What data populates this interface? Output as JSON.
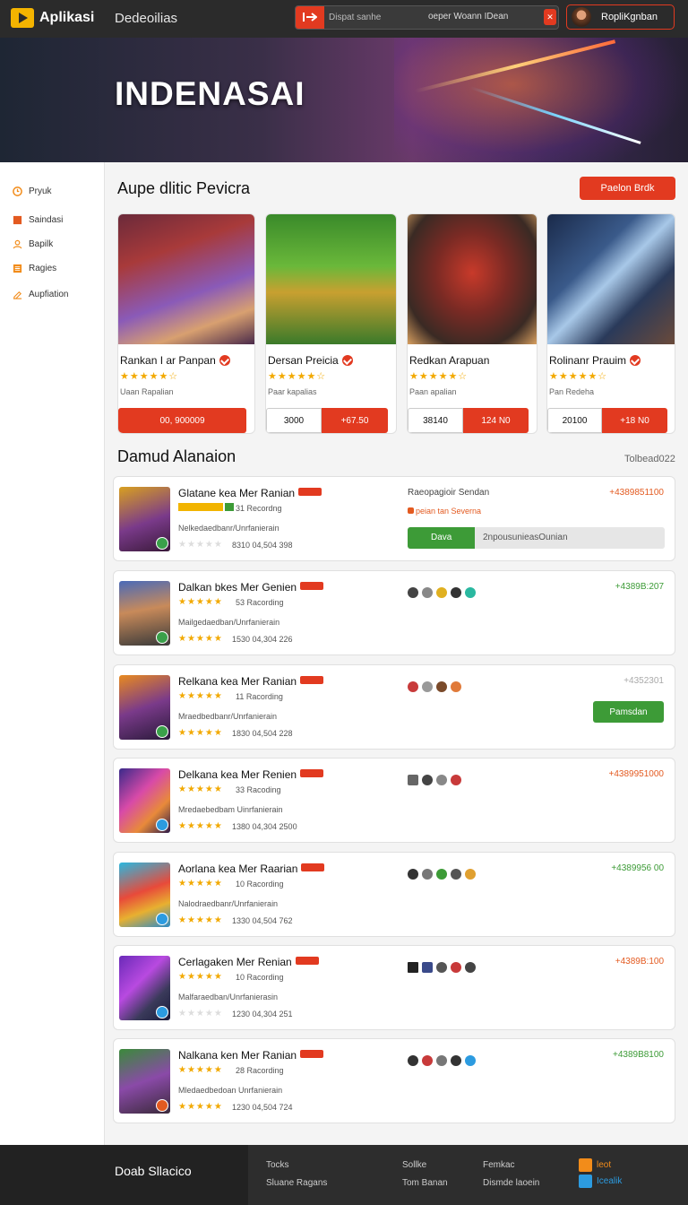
{
  "header": {
    "logo": "Aplikasi",
    "nav_link": "Dedeoilias",
    "search_placeholder": "Dispat sanhe",
    "search_hint": "oeper Woann IDean",
    "user_name": "RopliKgnban"
  },
  "hero": {
    "title": "INDENASAI"
  },
  "sidebar": {
    "items": [
      {
        "label": "Pryuk",
        "icon": "clock-icon"
      },
      {
        "label": "Saindasi",
        "icon": "square-icon"
      },
      {
        "label": "Bapilk",
        "icon": "user-icon"
      },
      {
        "label": "Ragies",
        "icon": "list-icon"
      },
      {
        "label": "Aupfiation",
        "icon": "edit-icon"
      }
    ]
  },
  "featured": {
    "title": "Aupe dlitic Pevicra",
    "cta_label": "Paelon Brdk",
    "cards": [
      {
        "name": "Rankan I ar Panpan",
        "rating": 4.5,
        "stars": "★★★★★☆",
        "sub": "Uaan Rapalian",
        "price_full": "00, 900009"
      },
      {
        "name": "Dersan Preicia",
        "rating": 4.5,
        "stars": "★★★★★☆",
        "sub": "Paar kapalias",
        "price_a": "3000",
        "price_b": "+67.50"
      },
      {
        "name": "Redkan Arapuan",
        "rating": 4.5,
        "stars": "★★★★★☆",
        "sub": "Paan apalian",
        "price_a": "38140",
        "price_b": "124 N0"
      },
      {
        "name": "Rolinanr Prauim",
        "rating": 4.5,
        "stars": "★★★★★☆",
        "sub": "Pan Redeha",
        "price_a": "20100",
        "price_b": "+18 N0"
      }
    ]
  },
  "list": {
    "title": "Damud Alanaion",
    "count": "Tolbead022",
    "rows": [
      {
        "title": "Glatane kea Mer Ranian",
        "stars": "★★★★★",
        "rate": "31  Recordng",
        "desc": "Nelkedaedbanr/Unrfanierain",
        "stars2": "★★★★★",
        "meta": "8310   04,504 398",
        "price": "+4389851100",
        "price_color": "#e35a20",
        "vendor_label": "Raeopagioir Sendan",
        "vendor_status": "peian tan Severna",
        "progress_left": "Dava",
        "progress_right": "2npousunieasOunian",
        "progress_fill": 0.26
      },
      {
        "title": "Dalkan bkes Mer Genien",
        "stars": "★★★★★",
        "rate": "53  Racording",
        "desc": "Mailgedaedban/Unrfanierain",
        "stars2": "★★★★★",
        "meta": "1530   04,304 226",
        "price": "+4389B:207",
        "price_color": "#3d9b37"
      },
      {
        "title": "Relkana kea Mer Ranian",
        "stars": "★★★★★",
        "rate": "11  Racording",
        "desc": "Mraedbedbanr/Unrfanierain",
        "stars2": "★★★★★",
        "meta": "1830   04,504 228",
        "price": "+4352301",
        "price_color": "#aaaaaa",
        "button": "Pamsdan"
      },
      {
        "title": "Delkana kea Mer Renien",
        "stars": "★★★★★",
        "rate": "33  Racoding",
        "desc": "Mredaebedbam Uinrfanierain",
        "stars2": "★★★★★",
        "meta": "1380   04,304 2500",
        "price": "+4389951000",
        "price_color": "#e35a20"
      },
      {
        "title": "Aorlana kea Mer Raarian",
        "stars": "★★★★★",
        "rate": "10  Racording",
        "desc": "Nalodraedbanr/Unrfanierain",
        "stars2": "★★★★★",
        "meta": "1330   04,504 762",
        "price": "+4389956 00",
        "price_color": "#3d9b37"
      },
      {
        "title": "Cerlagaken Mer Renian",
        "stars": "★★★★★",
        "rate": "10  Racording",
        "desc": "Malfaraedban/Unrfanierasin",
        "stars2": "★★★★★",
        "meta": "1230   04,304 251",
        "price": "+4389B:100",
        "price_color": "#e35a20"
      },
      {
        "title": "Nalkana ken Mer Ranian",
        "stars": "★★★★★",
        "rate": "28  Racording",
        "desc": "Mledaedbedoan Unrfanierain",
        "stars2": "★★★★★",
        "meta": "1230   04,504 724",
        "price": "+4389B8100",
        "price_color": "#3d9b37"
      }
    ]
  },
  "footer": {
    "brand": "Doab Sllacico",
    "col1": [
      "Tocks",
      "Sluane Ragans"
    ],
    "col2": [
      "Sollke",
      "Tom Banan"
    ],
    "col3": [
      "Femkac",
      "Dismde laoein"
    ],
    "social": [
      {
        "label": "leot",
        "color": "#f28c1a"
      },
      {
        "label": "Icealik",
        "color": "#2c9be0"
      }
    ]
  }
}
